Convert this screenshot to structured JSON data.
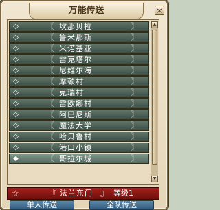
{
  "window": {
    "title": "万能传送",
    "close_label": "×"
  },
  "list": {
    "bracket_left": "〖",
    "bracket_right": "〗",
    "items": [
      {
        "marker": "◇",
        "name": "坎那贝拉"
      },
      {
        "marker": "◇",
        "name": "鲁米那斯"
      },
      {
        "marker": "◇",
        "name": "米诺基亚"
      },
      {
        "marker": "◇",
        "name": "雷克塔尔"
      },
      {
        "marker": "◇",
        "name": "尼维尔海"
      },
      {
        "marker": "◇",
        "name": "摩顿村"
      },
      {
        "marker": "◇",
        "name": "克瑞村"
      },
      {
        "marker": "◇",
        "name": "雷欧娜村"
      },
      {
        "marker": "◇",
        "name": "阿巴尼斯"
      },
      {
        "marker": "◇",
        "name": "魔法大学"
      },
      {
        "marker": "◇",
        "name": "哈贝鲁村"
      },
      {
        "marker": "◇",
        "name": "港口小镇"
      },
      {
        "marker": "◆",
        "name": "哥拉尔城"
      }
    ],
    "scroll_up": "▲",
    "scroll_down": "▼"
  },
  "destination": {
    "star": "☆",
    "bracket_left": "『",
    "name": "法兰东门",
    "bracket_right": "』",
    "level": "等级1"
  },
  "buttons": {
    "single": "单人传送",
    "team": "全队传送"
  }
}
